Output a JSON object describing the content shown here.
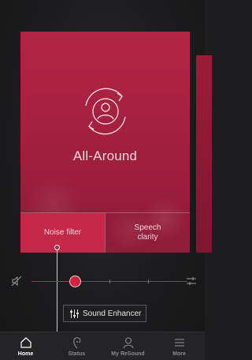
{
  "program": {
    "name": "All-Around",
    "icon": "program-person-cycle-icon"
  },
  "tabs": [
    {
      "label": "Noise filter",
      "active": true
    },
    {
      "label": "Speech clarity",
      "active": false
    }
  ],
  "volume": {
    "level": 0.28,
    "mute_icon": "speaker-muted-icon",
    "settings_icon": "equalizer-icon"
  },
  "enhancer": {
    "label": "Sound Enhancer",
    "icon": "sliders-icon"
  },
  "nav": [
    {
      "label": "Home",
      "icon": "home-icon",
      "active": true
    },
    {
      "label": "Status",
      "icon": "hearing-aid-icon",
      "active": false
    },
    {
      "label": "My ReSound",
      "icon": "user-icon",
      "active": false
    },
    {
      "label": "More",
      "icon": "menu-icon",
      "active": false
    }
  ],
  "colors": {
    "accent": "#c42849",
    "card": "#a01f3d",
    "background": "#1d1d1f"
  }
}
